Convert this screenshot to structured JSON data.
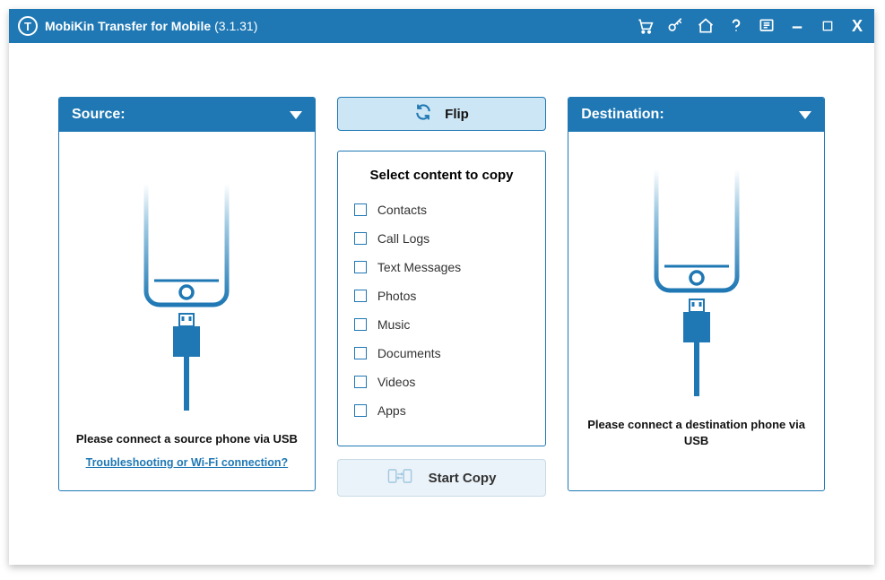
{
  "title": {
    "app_name": "MobiKin Transfer for Mobile",
    "version": "(3.1.31)"
  },
  "source_panel": {
    "header": "Source:",
    "message": "Please connect a source phone via USB",
    "link": "Troubleshooting or Wi-Fi connection?"
  },
  "destination_panel": {
    "header": "Destination:",
    "message": "Please connect a destination phone via USB"
  },
  "middle": {
    "flip_label": "Flip",
    "select_title": "Select content to copy",
    "items": [
      "Contacts",
      "Call Logs",
      "Text Messages",
      "Photos",
      "Music",
      "Documents",
      "Videos",
      "Apps"
    ],
    "start_label": "Start Copy"
  }
}
